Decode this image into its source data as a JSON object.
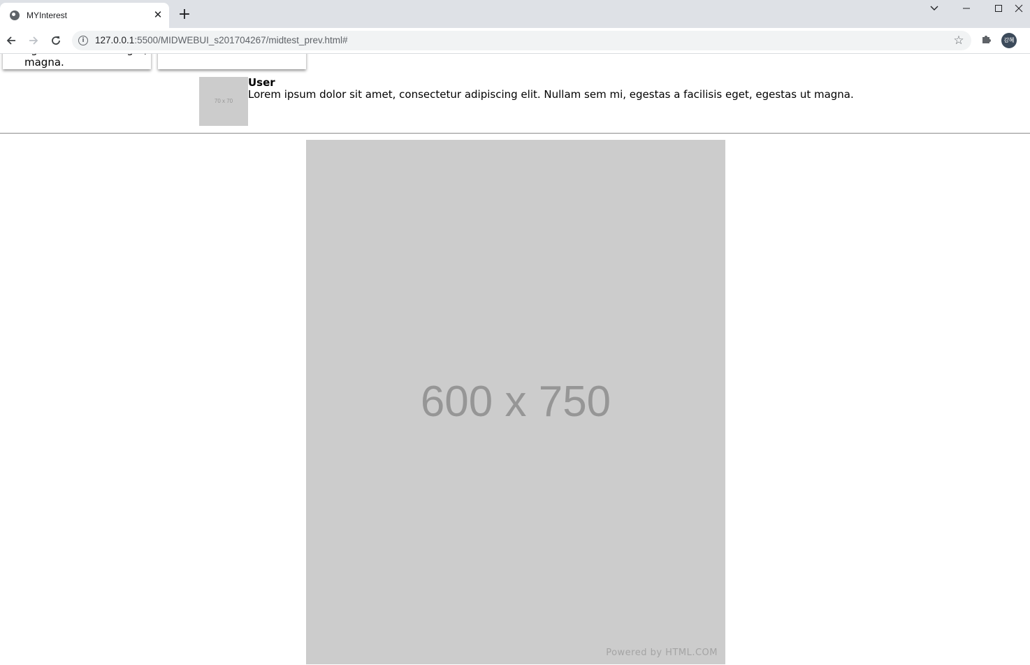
{
  "browser": {
    "tab_title": "MYInterest",
    "tab_close": "✕",
    "new_tab": "+",
    "url_host": "127.0.0.1",
    "url_rest": ":5500/MIDWEBUI_s201704267/midtest_prev.html#",
    "profile_initials": "강혜",
    "icons": {
      "favicon": "globe-icon",
      "back": "arrow-left-icon",
      "forward": "arrow-right-icon",
      "reload": "reload-icon",
      "info": "info-icon",
      "bookmark": "star-icon",
      "extensions": "puzzle-icon",
      "tab_search": "chevron-down-icon",
      "minimize": "minimize-icon",
      "maximize": "maximize-icon",
      "close": "close-icon"
    }
  },
  "cards": [
    {
      "text": "magna."
    },
    {
      "text": ""
    }
  ],
  "post": {
    "avatar_label": "70 x 70",
    "username": "User",
    "description": "Lorem ipsum dolor sit amet, consectetur adipiscing elit. Nullam sem mi, egestas a facilisis eget, egestas ut magna."
  },
  "main_image": {
    "label": "600 x 750",
    "credit": "Powered by HTML.COM"
  },
  "colors": {
    "placeholder_bg": "#cccccc",
    "placeholder_text": "#969696",
    "chrome_bg": "#dee1e6"
  }
}
